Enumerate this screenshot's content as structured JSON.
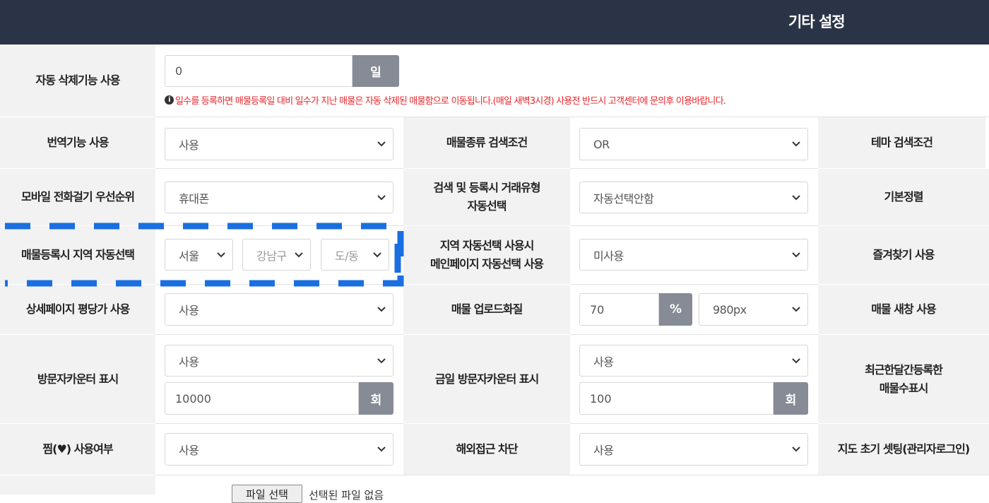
{
  "header": {
    "title": "기타 설정"
  },
  "auto_delete": {
    "label": "자동 삭제기능 사용",
    "value": "0",
    "unit": "일",
    "notice": "일수를 등록하면 매물등록일 대비 일수가 지난 매물은 자동 삭제된 매물함으로 이동됩니다.(매일 새벽3시경) 사용전 반드시 고객센터에 문의후 이용바랍니다."
  },
  "rows": {
    "translate": {
      "label": "번역기능 사용",
      "value": "사용"
    },
    "listing_type_search": {
      "label": "매물종류 검색조건",
      "value": "OR"
    },
    "theme_search": {
      "label": "테마 검색조건"
    },
    "mobile_call": {
      "label": "모바일 전화걸기 우선순위",
      "value": "휴대폰"
    },
    "trade_auto": {
      "label_1": "검색 및 등록시 거래유형",
      "label_2": "자동선택",
      "value": "자동선택안함"
    },
    "default_sort": {
      "label": "기본정렬"
    },
    "region_auto": {
      "label": "매물등록시 지역 자동선택",
      "city": "서울",
      "district": "강남구",
      "dong": "도/동"
    },
    "region_main": {
      "label_1": "지역 자동선택 사용시",
      "label_2": "메인페이지 자동선택 사용",
      "value": "미사용"
    },
    "favorites": {
      "label": "즐겨찾기 사용"
    },
    "pyeong_price": {
      "label": "상세페이지 평당가 사용",
      "value": "사용"
    },
    "upload_quality": {
      "label": "매물 업로드화질",
      "value": "70",
      "unit": "%",
      "width_value": "980px"
    },
    "new_window": {
      "label": "매물 새창 사용"
    },
    "visitor_counter": {
      "label": "방문자카운터 표시",
      "value": "사용",
      "count": "10000",
      "unit": "회"
    },
    "today_counter": {
      "label": "금일 방문자카운터 표시",
      "value": "사용",
      "count": "100",
      "unit": "회"
    },
    "recent_month": {
      "label_1": "최근한달간등록한",
      "label_2": "매물수표시"
    },
    "like_use": {
      "label": "찜(♥) 사용여부",
      "value": "사용"
    },
    "block_foreign": {
      "label": "해외접근 차단",
      "value": "사용"
    },
    "map_init": {
      "label": "지도 초기 셋팅(관리자로그인)"
    },
    "file": {
      "button": "파일 선택",
      "status": "선택된 파일 없음"
    }
  },
  "colors": {
    "header_bg": "#2b3447",
    "label_bg": "#f2f2f2",
    "addon_bg": "#868b96",
    "notice": "#e8262c",
    "dash": "#1a6fe0"
  },
  "icons": {
    "select_arrow": "chevron-down-icon",
    "notice": "info-icon"
  }
}
